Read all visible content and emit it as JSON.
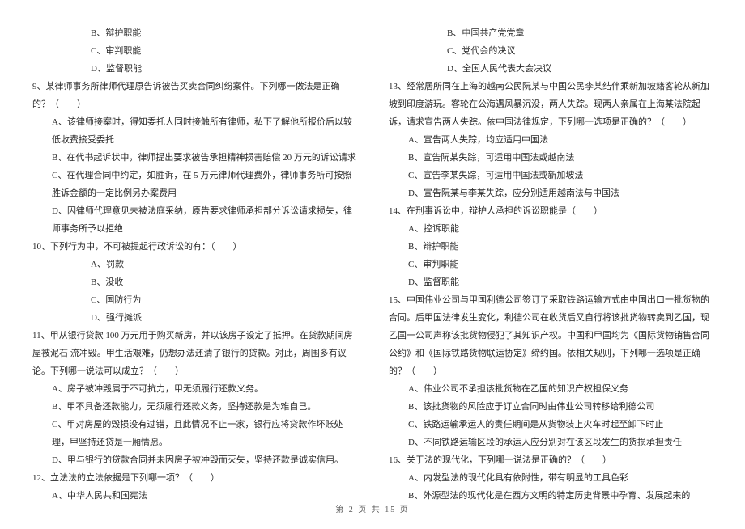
{
  "left": {
    "q8_opts_tail": [
      "B、辩护职能",
      "C、审判职能",
      "D、监督职能"
    ],
    "q9": {
      "stem": "9、某律师事务所律师代理原告诉被告买卖合同纠纷案件。下列哪一做法是正确的？（　　）",
      "opts": [
        "A、该律师接案时，得知委托人同时接触所有律师，私下了解他所报价后以较低收费接受委托",
        "B、在代书起诉状中，律师提出要求被告承担精神损害赔偿 20 万元的诉讼请求",
        "C、在代理合同中约定，如胜诉，在 5 万元律师代理费外，律师事务所可按照胜诉金额的一定比例另办案费用",
        "D、因律师代理意见未被法庭采纳，原告要求律师承担部分诉讼请求损失，律师事务所予以拒绝"
      ]
    },
    "q10": {
      "stem": "10、下列行为中，不可被提起行政诉讼的有：（　　）",
      "opts": [
        "A、罚款",
        "B、没收",
        "C、国防行为",
        "D、强行摊派"
      ]
    },
    "q11": {
      "stem1": "11、甲从银行贷款 100 万元用于购买新房，并以该房子设定了抵押。在贷款期间房屋被泥石 流冲毁。甲生活艰难，仍想办法还清了银行的贷款。对此，周围多有议论。下列哪一说法可以成立？（　　）",
      "opts": [
        "A、房子被冲毁属于不可抗力，甲无须履行还款义务。",
        "B、甲不具备还款能力，无须履行还款义务，坚持还款是为难自己。",
        "C、甲对房屋的毁损没有过错，且此情况不止一家，银行应将贷款作坏账处理，甲坚持还贷是一厢情愿。",
        "D、甲与银行的贷款合同并未因房子被冲毁而灭失，坚持还款是诚实信用。"
      ]
    },
    "q12": {
      "stem": "12、立法法的立法依据是下列哪一项？（　　）",
      "opts_head": [
        "A、中华人民共和国宪法"
      ]
    }
  },
  "right": {
    "q12_opts_tail": [
      "B、中国共产党党章",
      "C、党代会的决议",
      "D、全国人民代表大会决议"
    ],
    "q13": {
      "stem": "13、经常居所同在上海的越南公民阮某与中国公民李某结伴乘新加坡籍客轮从新加坡到印度游玩。客轮在公海遇风暴沉没，两人失踪。现两人亲属在上海某法院起诉，请求宣告两人失踪。依中国法律规定，下列哪一选项是正确的？（　　）",
      "opts": [
        "A、宣告两人失踪，均应适用中国法",
        "B、宣告阮某失踪，可适用中国法或越南法",
        "C、宣告李某失踪，可适用中国法或新加坡法",
        "D、宣告阮某与李某失踪，应分别适用越南法与中国法"
      ]
    },
    "q14": {
      "stem": "14、在刑事诉讼中，辩护人承担的诉讼职能是（　　）",
      "opts": [
        "A、控诉职能",
        "B、辩护职能",
        "C、审判职能",
        "D、监督职能"
      ]
    },
    "q15": {
      "stem": "15、中国伟业公司与甲国利德公司签订了采取铁路运输方式由中国出口一批货物的合同。后甲国法律发生变化，利德公司在收货后又自行将该批货物转卖到乙国，现乙国一公司声称该批货物侵犯了其知识产权。中国和甲国均为《国际货物销售合同公约》和《国际铁路货物联运协定》缔约国。依相关规则，下列哪一选项是正确的？（　　）",
      "opts": [
        "A、伟业公司不承担该批货物在乙国的知识产权担保义务",
        "B、该批货物的风险应于订立合同时由伟业公司转移给利德公司",
        "C、铁路运输承运人的责任期间是从货物装上火车时起至卸下时止",
        "D、不同铁路运输区段的承运人应分别对在该区段发生的货损承担责任"
      ]
    },
    "q16": {
      "stem": "16、关于法的现代化，下列哪一说法是正确的？（　　）",
      "opts_head": [
        "A、内发型法的现代化具有依附性，带有明显的工具色彩",
        "B、外源型法的现代化是在西方文明的特定历史背景中孕育、发展起来的"
      ]
    }
  },
  "footer": "第 2 页 共 15 页"
}
